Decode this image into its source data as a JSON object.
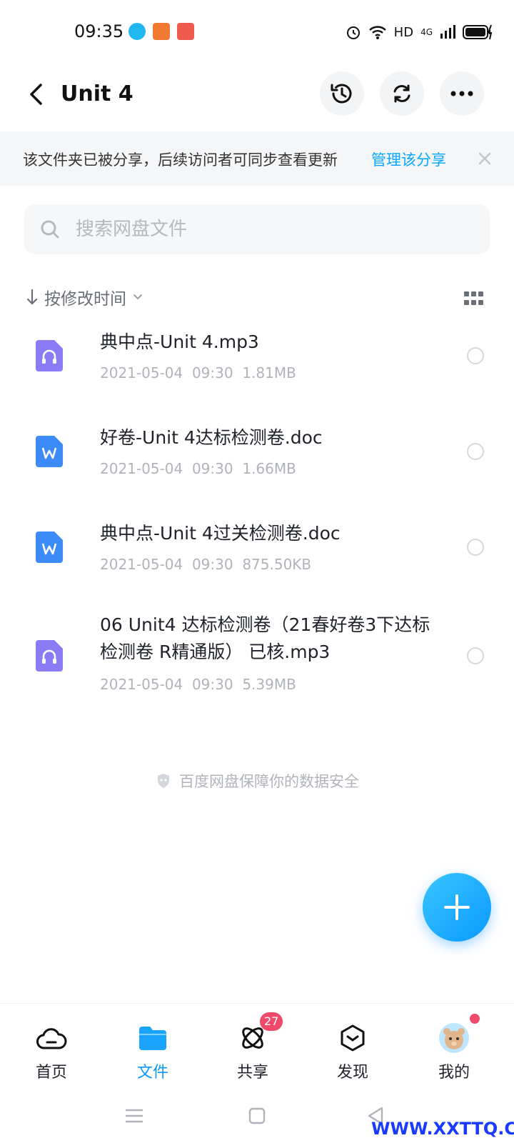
{
  "status_bar": {
    "time": "09:35",
    "network": "HD",
    "signal": "4G"
  },
  "header": {
    "title": "Unit 4"
  },
  "banner": {
    "text": "该文件夹已被分享，后续访问者可同步查看更新",
    "link": "管理该分享"
  },
  "search": {
    "placeholder": "搜索网盘文件"
  },
  "sort": {
    "label": "按修改时间"
  },
  "files": [
    {
      "name": "典中点-Unit 4.mp3",
      "date": "2021-05-04",
      "time": "09:30",
      "size": "1.81MB",
      "type": "audio"
    },
    {
      "name": "好卷-Unit 4达标检测卷.doc",
      "date": "2021-05-04",
      "time": "09:30",
      "size": "1.66MB",
      "type": "doc"
    },
    {
      "name": "典中点-Unit 4过关检测卷.doc",
      "date": "2021-05-04",
      "time": "09:30",
      "size": "875.50KB",
      "type": "doc"
    },
    {
      "name": "06 Unit4 达标检测卷（21春好卷3下达标检测卷 R精通版） 已核.mp3",
      "date": "2021-05-04",
      "time": "09:30",
      "size": "5.39MB",
      "type": "audio"
    }
  ],
  "safe_note": "百度网盘保障你的数据安全",
  "nav": {
    "items": [
      {
        "label": "首页",
        "icon": "cloud-home-icon"
      },
      {
        "label": "文件",
        "icon": "folder-icon"
      },
      {
        "label": "共享",
        "icon": "share-atom-icon",
        "badge": "27"
      },
      {
        "label": "发现",
        "icon": "discover-box-icon"
      },
      {
        "label": "我的",
        "icon": "avatar-icon"
      }
    ],
    "active_color": "#0b98ff"
  },
  "watermark": "WWW.XXTTQ.COM",
  "colors": {
    "accent": "#06a7ff",
    "audio_icon": "#8b7cf6",
    "doc_icon": "#3d8bf8",
    "badge": "#f04a6a"
  }
}
